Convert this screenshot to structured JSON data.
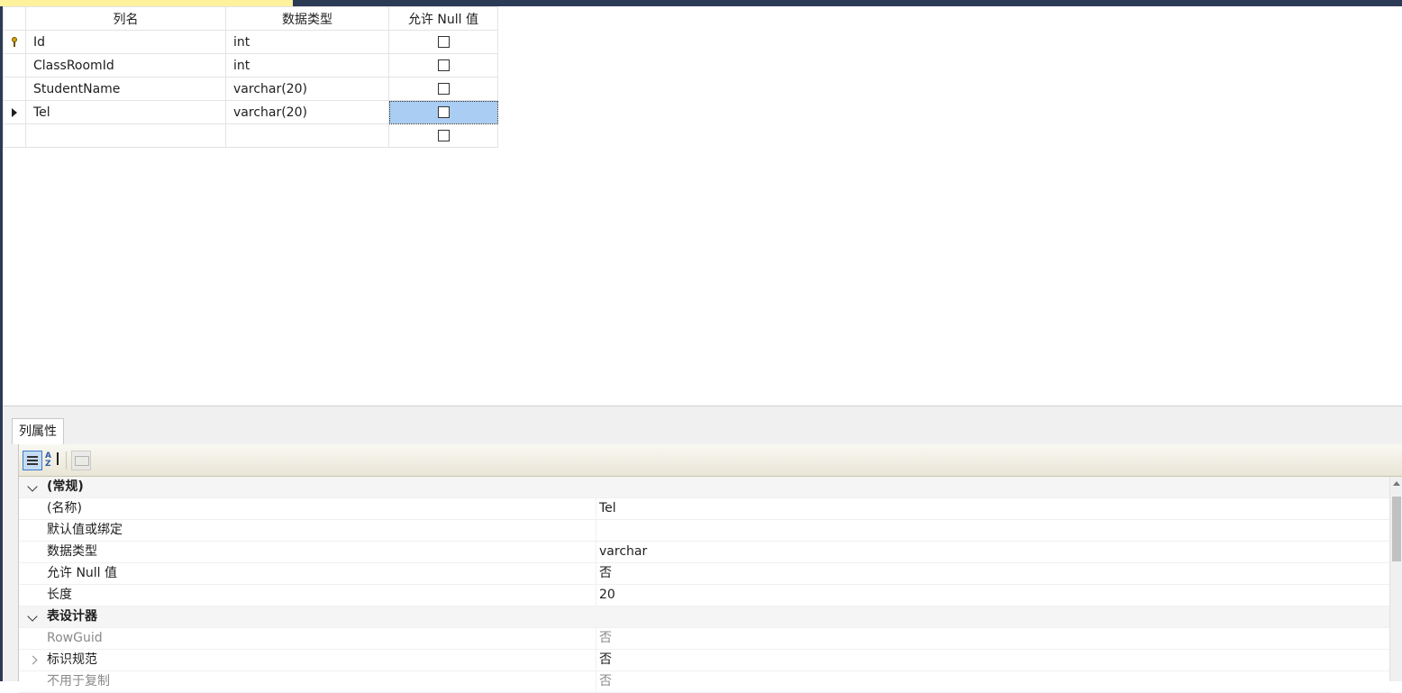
{
  "grid": {
    "headers": [
      "列名",
      "数据类型",
      "允许 Null 值"
    ],
    "rows": [
      {
        "name": "Id",
        "type": "int",
        "allow_null": false,
        "marker": "key-icon"
      },
      {
        "name": "ClassRoomId",
        "type": "int",
        "allow_null": false,
        "marker": ""
      },
      {
        "name": "StudentName",
        "type": "varchar(20)",
        "allow_null": false,
        "marker": ""
      },
      {
        "name": "Tel",
        "type": "varchar(20)",
        "allow_null": false,
        "marker": "current-row-arrow-icon"
      },
      {
        "name": "",
        "type": "",
        "allow_null": false,
        "marker": ""
      }
    ]
  },
  "props": {
    "tab_label": "列属性",
    "toolbar": {
      "sort_alpha_label": "A Z"
    },
    "rows": [
      {
        "kind": "category",
        "name": "(常规)",
        "value": ""
      },
      {
        "kind": "prop",
        "name": "(名称)",
        "value": "Tel"
      },
      {
        "kind": "prop",
        "name": "默认值或绑定",
        "value": ""
      },
      {
        "kind": "prop",
        "name": "数据类型",
        "value": "varchar"
      },
      {
        "kind": "prop",
        "name": "允许 Null 值",
        "value": "否"
      },
      {
        "kind": "prop",
        "name": "长度",
        "value": "20"
      },
      {
        "kind": "category",
        "name": "表设计器",
        "value": ""
      },
      {
        "kind": "prop-dim",
        "name": "RowGuid",
        "value": "否"
      },
      {
        "kind": "prop-expandable",
        "name": "标识规范",
        "value": "否"
      },
      {
        "kind": "prop-dim",
        "name": "不用于复制",
        "value": "否"
      }
    ]
  },
  "colors": {
    "accent": "#2b3a55",
    "selection": "#a9cdf3",
    "doc_tab": "#fff29d"
  }
}
